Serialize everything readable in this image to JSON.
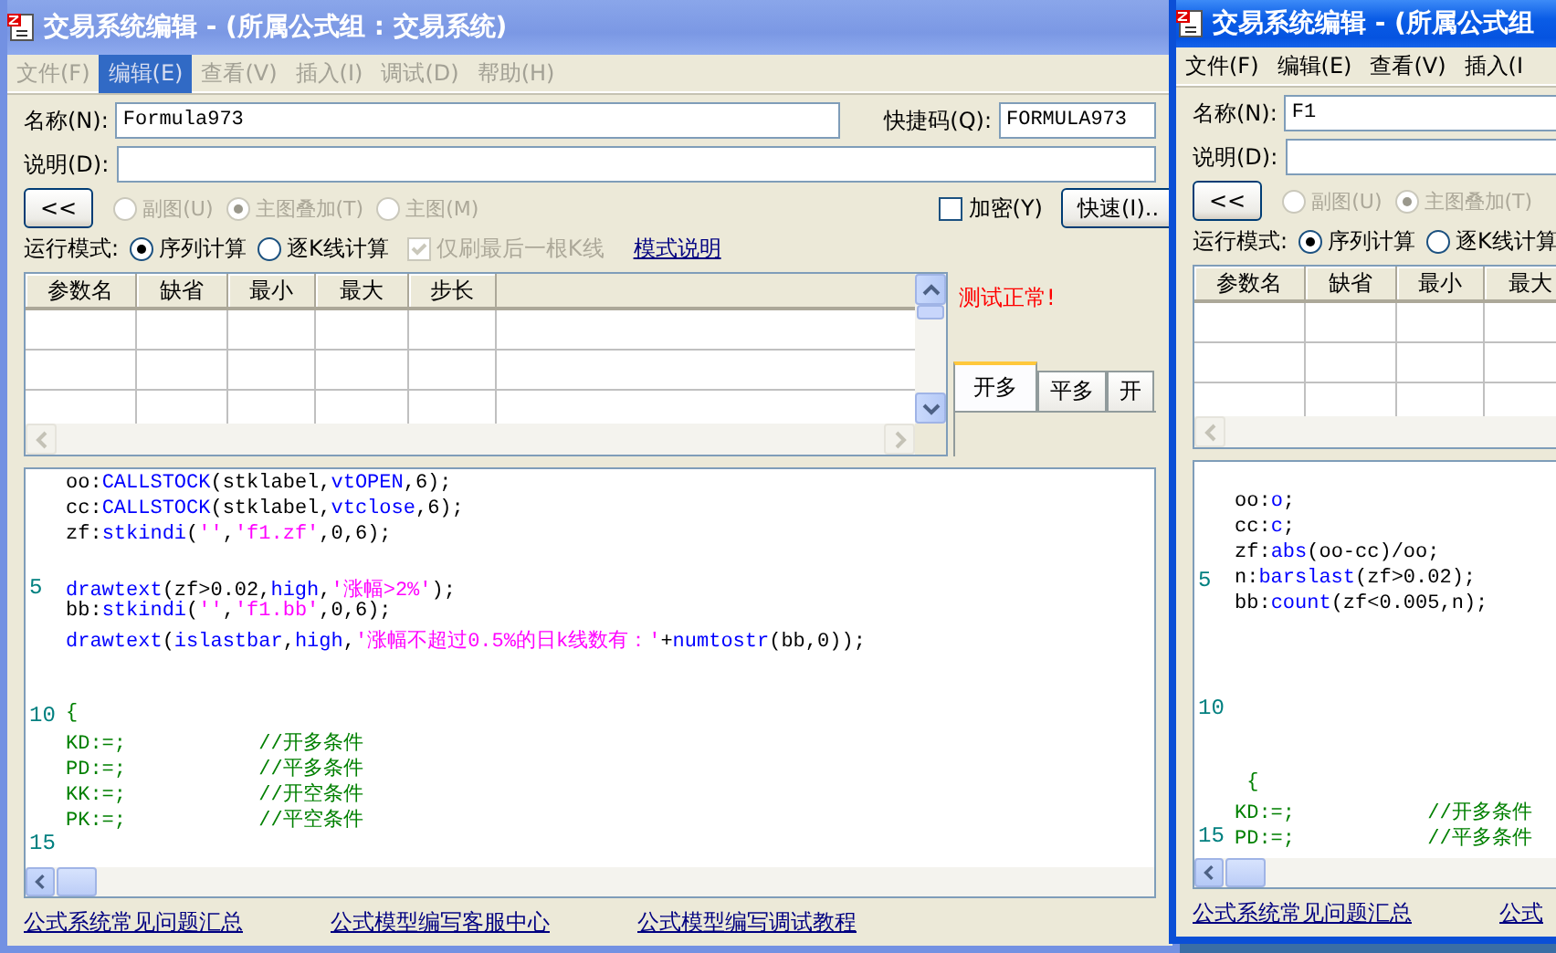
{
  "windows": [
    {
      "title": "交易系统编辑 - (所属公式组 : 交易系统)",
      "active": false,
      "menu": [
        {
          "label": "文件(F)",
          "selected": false
        },
        {
          "label": "编辑(E)",
          "selected": true
        },
        {
          "label": "查看(V)",
          "selected": false
        },
        {
          "label": "插入(I)",
          "selected": false
        },
        {
          "label": "调试(D)",
          "selected": false
        },
        {
          "label": "帮助(H)",
          "selected": false
        }
      ],
      "name_field": {
        "label": "名称(N):",
        "value": "Formula973"
      },
      "shortcut_field": {
        "label": "快捷码(Q):",
        "value": "FORMULA973"
      },
      "description_field": {
        "label": "说明(D):"
      },
      "collapse_button": "<<",
      "chart_options": [
        {
          "label": "副图(U)",
          "selected": false,
          "disabled": true
        },
        {
          "label": "主图叠加(T)",
          "selected": true,
          "disabled": true
        },
        {
          "label": "主图(M)",
          "selected": false,
          "disabled": true
        }
      ],
      "encrypt": {
        "label": "加密(Y)",
        "checked": false
      },
      "quick_button": "快速(I)..",
      "run_mode": {
        "label": "运行模式:",
        "options": [
          {
            "label": "序列计算",
            "selected": true
          },
          {
            "label": "逐K线计算",
            "selected": false
          }
        ],
        "refresh_last": {
          "label": "仅刷最后一根K线",
          "checked": true,
          "disabled": true
        },
        "help_link": "模式说明"
      },
      "params_table": {
        "columns": [
          "参数名",
          "缺省",
          "最小",
          "最大",
          "步长"
        ]
      },
      "test_status": "测试正常!",
      "tabs": [
        {
          "label": "开多",
          "selected": true
        },
        {
          "label": "平多",
          "selected": false
        },
        {
          "label": "开",
          "selected": false
        }
      ],
      "code_lines": [
        {
          "kind": "code",
          "tokens": [
            {
              "kind": "text",
              "text": "oo:"
            },
            {
              "kind": "function",
              "text": "CALLSTOCK"
            },
            {
              "kind": "text",
              "text": "(stklabel,"
            },
            {
              "kind": "function",
              "text": "vtOPEN"
            },
            {
              "kind": "text",
              "text": ",6);"
            }
          ]
        },
        {
          "kind": "code",
          "tokens": [
            {
              "kind": "text",
              "text": "cc:"
            },
            {
              "kind": "function",
              "text": "CALLSTOCK"
            },
            {
              "kind": "text",
              "text": "(stklabel,"
            },
            {
              "kind": "function",
              "text": "vtclose"
            },
            {
              "kind": "text",
              "text": ",6);"
            }
          ]
        },
        {
          "kind": "code",
          "tokens": [
            {
              "kind": "text",
              "text": "zf:"
            },
            {
              "kind": "function",
              "text": "stkindi"
            },
            {
              "kind": "text",
              "text": "("
            },
            {
              "kind": "string",
              "text": "''"
            },
            {
              "kind": "text",
              "text": ","
            },
            {
              "kind": "string",
              "text": "'f1.zf'"
            },
            {
              "kind": "text",
              "text": ",0,6);"
            }
          ]
        },
        {
          "kind": "blank"
        },
        {
          "kind": "code",
          "number": "5",
          "tokens": [
            {
              "kind": "function",
              "text": "drawtext"
            },
            {
              "kind": "text",
              "text": "(zf>0.02,"
            },
            {
              "kind": "function",
              "text": "high"
            },
            {
              "kind": "text",
              "text": ","
            },
            {
              "kind": "string",
              "text": "'涨幅>2%'"
            },
            {
              "kind": "text",
              "text": ");"
            }
          ]
        },
        {
          "kind": "code",
          "tokens": [
            {
              "kind": "text",
              "text": "bb:"
            },
            {
              "kind": "function",
              "text": "stkindi"
            },
            {
              "kind": "text",
              "text": "("
            },
            {
              "kind": "string",
              "text": "''"
            },
            {
              "kind": "text",
              "text": ","
            },
            {
              "kind": "string",
              "text": "'f1.bb'"
            },
            {
              "kind": "text",
              "text": ",0,6);"
            }
          ]
        },
        {
          "kind": "code",
          "tokens": [
            {
              "kind": "function",
              "text": "drawtext"
            },
            {
              "kind": "text",
              "text": "("
            },
            {
              "kind": "function",
              "text": "islastbar"
            },
            {
              "kind": "text",
              "text": ","
            },
            {
              "kind": "function",
              "text": "high"
            },
            {
              "kind": "text",
              "text": ","
            },
            {
              "kind": "string",
              "text": "'涨幅不超过0.5%的日k线数有：'"
            },
            {
              "kind": "text",
              "text": "+"
            },
            {
              "kind": "function",
              "text": "numtostr"
            },
            {
              "kind": "text",
              "text": "(bb,0));"
            }
          ]
        },
        {
          "kind": "blank"
        },
        {
          "kind": "blank"
        },
        {
          "kind": "code",
          "number": "10",
          "tokens": [
            {
              "kind": "comment",
              "text": "{"
            }
          ]
        },
        {
          "kind": "code",
          "tokens": [
            {
              "kind": "comment",
              "text": "KD:=;           //开多条件"
            }
          ]
        },
        {
          "kind": "code",
          "tokens": [
            {
              "kind": "comment",
              "text": "PD:=;           //平多条件"
            }
          ]
        },
        {
          "kind": "code",
          "tokens": [
            {
              "kind": "comment",
              "text": "KK:=;           //开空条件"
            }
          ]
        },
        {
          "kind": "code",
          "tokens": [
            {
              "kind": "comment",
              "text": "PK:=;           //平空条件"
            }
          ]
        },
        {
          "kind": "blank",
          "number": "15"
        }
      ],
      "links": [
        "公式系统常见问题汇总",
        "公式模型编写客服中心",
        "公式模型编写调试教程"
      ]
    },
    {
      "title": "交易系统编辑 - (所属公式组",
      "active": true,
      "menu": [
        {
          "label": "文件(F)",
          "selected": false
        },
        {
          "label": "编辑(E)",
          "selected": false
        },
        {
          "label": "查看(V)",
          "selected": false
        },
        {
          "label": "插入(I",
          "selected": false
        }
      ],
      "name_field": {
        "label": "名称(N):",
        "value": "F1"
      },
      "description_field": {
        "label": "说明(D):"
      },
      "collapse_button": "<<",
      "chart_options": [
        {
          "label": "副图(U)",
          "selected": false,
          "disabled": true
        },
        {
          "label": "主图叠加(T)",
          "selected": true,
          "disabled": true
        }
      ],
      "run_mode": {
        "label": "运行模式:",
        "options": [
          {
            "label": "序列计算",
            "selected": true
          },
          {
            "label": "逐K线计算",
            "selected": false
          }
        ]
      },
      "params_table": {
        "columns": [
          "参数名",
          "缺省",
          "最小",
          "最大"
        ]
      },
      "code_lines": [
        {
          "kind": "blank"
        },
        {
          "kind": "code",
          "tokens": [
            {
              "kind": "text",
              "text": "oo:"
            },
            {
              "kind": "function",
              "text": "o"
            },
            {
              "kind": "text",
              "text": ";"
            }
          ]
        },
        {
          "kind": "code",
          "tokens": [
            {
              "kind": "text",
              "text": "cc:"
            },
            {
              "kind": "function",
              "text": "c"
            },
            {
              "kind": "text",
              "text": ";"
            }
          ]
        },
        {
          "kind": "code",
          "tokens": [
            {
              "kind": "text",
              "text": "zf:"
            },
            {
              "kind": "function",
              "text": "abs"
            },
            {
              "kind": "text",
              "text": "(oo-cc)/oo;"
            }
          ]
        },
        {
          "kind": "code",
          "number": "5",
          "tokens": [
            {
              "kind": "text",
              "text": "n:"
            },
            {
              "kind": "function",
              "text": "barslast"
            },
            {
              "kind": "text",
              "text": "(zf>0.02);"
            }
          ]
        },
        {
          "kind": "code",
          "tokens": [
            {
              "kind": "text",
              "text": "bb:"
            },
            {
              "kind": "function",
              "text": "count"
            },
            {
              "kind": "text",
              "text": "(zf<0.005,n);"
            }
          ]
        },
        {
          "kind": "blank"
        },
        {
          "kind": "blank"
        },
        {
          "kind": "blank"
        },
        {
          "kind": "blank",
          "number": "10"
        },
        {
          "kind": "blank"
        },
        {
          "kind": "blank"
        },
        {
          "kind": "code",
          "tokens": [
            {
              "kind": "comment",
              "text": " {"
            }
          ]
        },
        {
          "kind": "code",
          "tokens": [
            {
              "kind": "comment",
              "text": "KD:=;           //开多条件"
            }
          ]
        },
        {
          "kind": "code",
          "number": "15",
          "tokens": [
            {
              "kind": "comment",
              "text": "PD:=;           //平多条件"
            }
          ]
        }
      ],
      "links": [
        "公式系统常见问题汇总",
        "公式"
      ]
    }
  ]
}
